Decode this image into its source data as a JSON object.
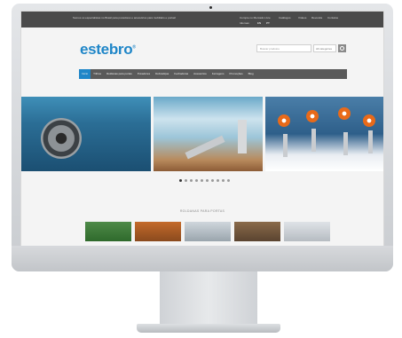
{
  "topbar": {
    "left_text": "Somos os especialistas no Brasil para puxadores e acessórios para mobiliário e portas!",
    "links": [
      "Compre no Mercado Livre",
      "Catálogos",
      "Vídeos",
      "Revenda",
      "Contatos"
    ],
    "language_label": "Idiomas:",
    "languages": [
      "EN",
      "PT"
    ]
  },
  "logo": {
    "text": "estebro",
    "mark": "®"
  },
  "search": {
    "placeholder": "Buscar produtos",
    "category": "All categories"
  },
  "nav": {
    "items": [
      "Início",
      "Trilhos",
      "Roldanas para portas",
      "Puxadores",
      "Dobradiças",
      "Fechaduras",
      "Acessórios",
      "Ferragens",
      "Promoções",
      "Blog"
    ]
  },
  "slider": {
    "count": 10,
    "active_index": 0
  },
  "section": {
    "title": "ROLDANAS PARA PORTAS"
  },
  "colors": {
    "accent": "#1f86c8",
    "topbar": "#4a4a4a",
    "nav": "#5a5a5a"
  }
}
